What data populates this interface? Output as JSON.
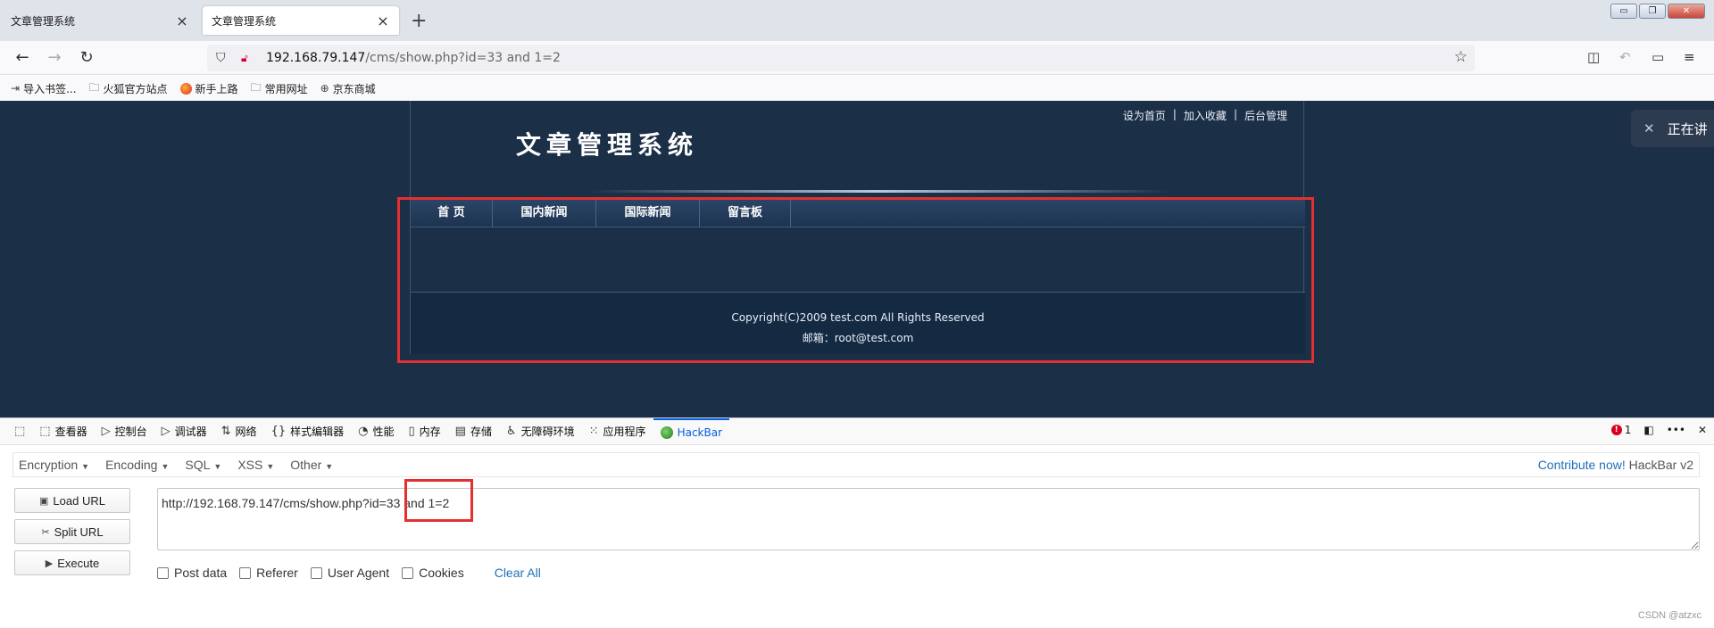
{
  "browser": {
    "tabs": [
      {
        "title": "文章管理系统",
        "close": "×"
      },
      {
        "title": "文章管理系统",
        "close": "×"
      }
    ],
    "new_tab": "+",
    "window_buttons": {
      "minimize": "▭",
      "restore": "❐",
      "close": "✕"
    },
    "nav": {
      "back": "←",
      "forward": "→",
      "reload": "↻"
    },
    "url_host": "192.168.79.147",
    "url_path": "/cms/show.php?id=33 and 1=2",
    "bookmarks": [
      {
        "icon": "import-icon",
        "label": "导入书签..."
      },
      {
        "icon": "folder-icon",
        "label": "火狐官方站点"
      },
      {
        "icon": "firefox-icon",
        "label": "新手上路"
      },
      {
        "icon": "folder-icon",
        "label": "常用网址"
      },
      {
        "icon": "globe-icon",
        "label": "京东商城"
      }
    ]
  },
  "site": {
    "top_links": [
      "设为首页",
      "加入收藏",
      "后台管理"
    ],
    "separator": "|",
    "title": "文章管理系统",
    "menu": [
      "首 页",
      "国内新闻",
      "国际新闻",
      "留言板"
    ],
    "footer_line1": "Copyright(C)2009 test.com All Rights Reserved",
    "footer_line2": "邮箱：root@test.com",
    "voice_label": "正在讲"
  },
  "devtools": {
    "tabs": [
      "查看器",
      "控制台",
      "调试器",
      "网络",
      "样式编辑器",
      "性能",
      "内存",
      "存储",
      "无障碍环境",
      "应用程序",
      "HackBar"
    ],
    "error_count": "1",
    "more": "•••",
    "close": "✕"
  },
  "hackbar": {
    "menu": [
      "Encryption",
      "Encoding",
      "SQL",
      "XSS",
      "Other"
    ],
    "contribute": "Contribute now!",
    "version": "HackBar v2",
    "buttons": {
      "load_url": "Load URL",
      "split_url": "Split URL",
      "execute": "Execute"
    },
    "url_value": "http://192.168.79.147/cms/show.php?id=33 and 1=2",
    "checkboxes": [
      "Post data",
      "Referer",
      "User Agent",
      "Cookies"
    ],
    "clear_all": "Clear All"
  },
  "watermark": "CSDN @atzxc",
  "colors": {
    "page_bg": "#1b2f47",
    "highlight_red": "#e53030",
    "link_blue": "#1f70b9"
  }
}
